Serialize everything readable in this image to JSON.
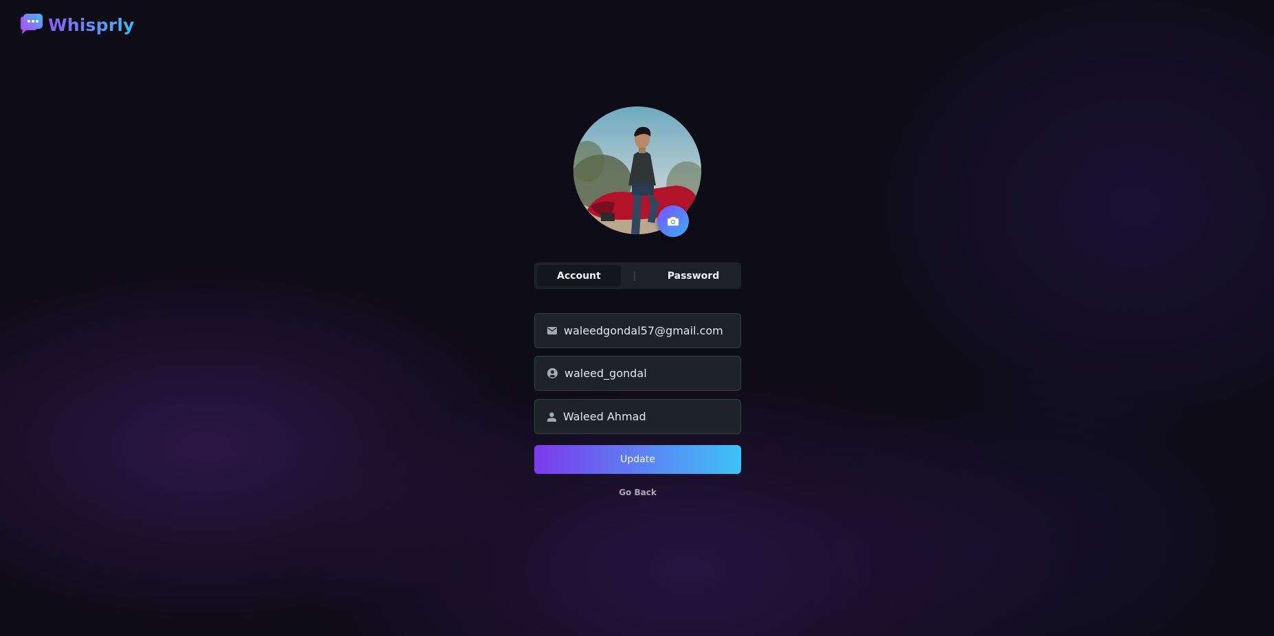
{
  "brand": {
    "name": "Whisprly"
  },
  "profile": {
    "avatar_alt": "Profile photo"
  },
  "tabs": [
    {
      "label": "Account",
      "active": true
    },
    {
      "label": "Password",
      "active": false
    }
  ],
  "tab_separator": "|",
  "form": {
    "email": {
      "value": "waleedgondal57@gmail.com",
      "icon": "mail-icon"
    },
    "username": {
      "value": "waleed_gondal",
      "icon": "account-circle-icon"
    },
    "full_name": {
      "value": "Waleed Ahmad",
      "icon": "person-icon"
    },
    "update_label": "Update",
    "go_back_label": "Go Back"
  },
  "colors": {
    "accent_start": "#7c3aed",
    "accent_end": "#3ec4f7",
    "background": "#0e0c17"
  }
}
